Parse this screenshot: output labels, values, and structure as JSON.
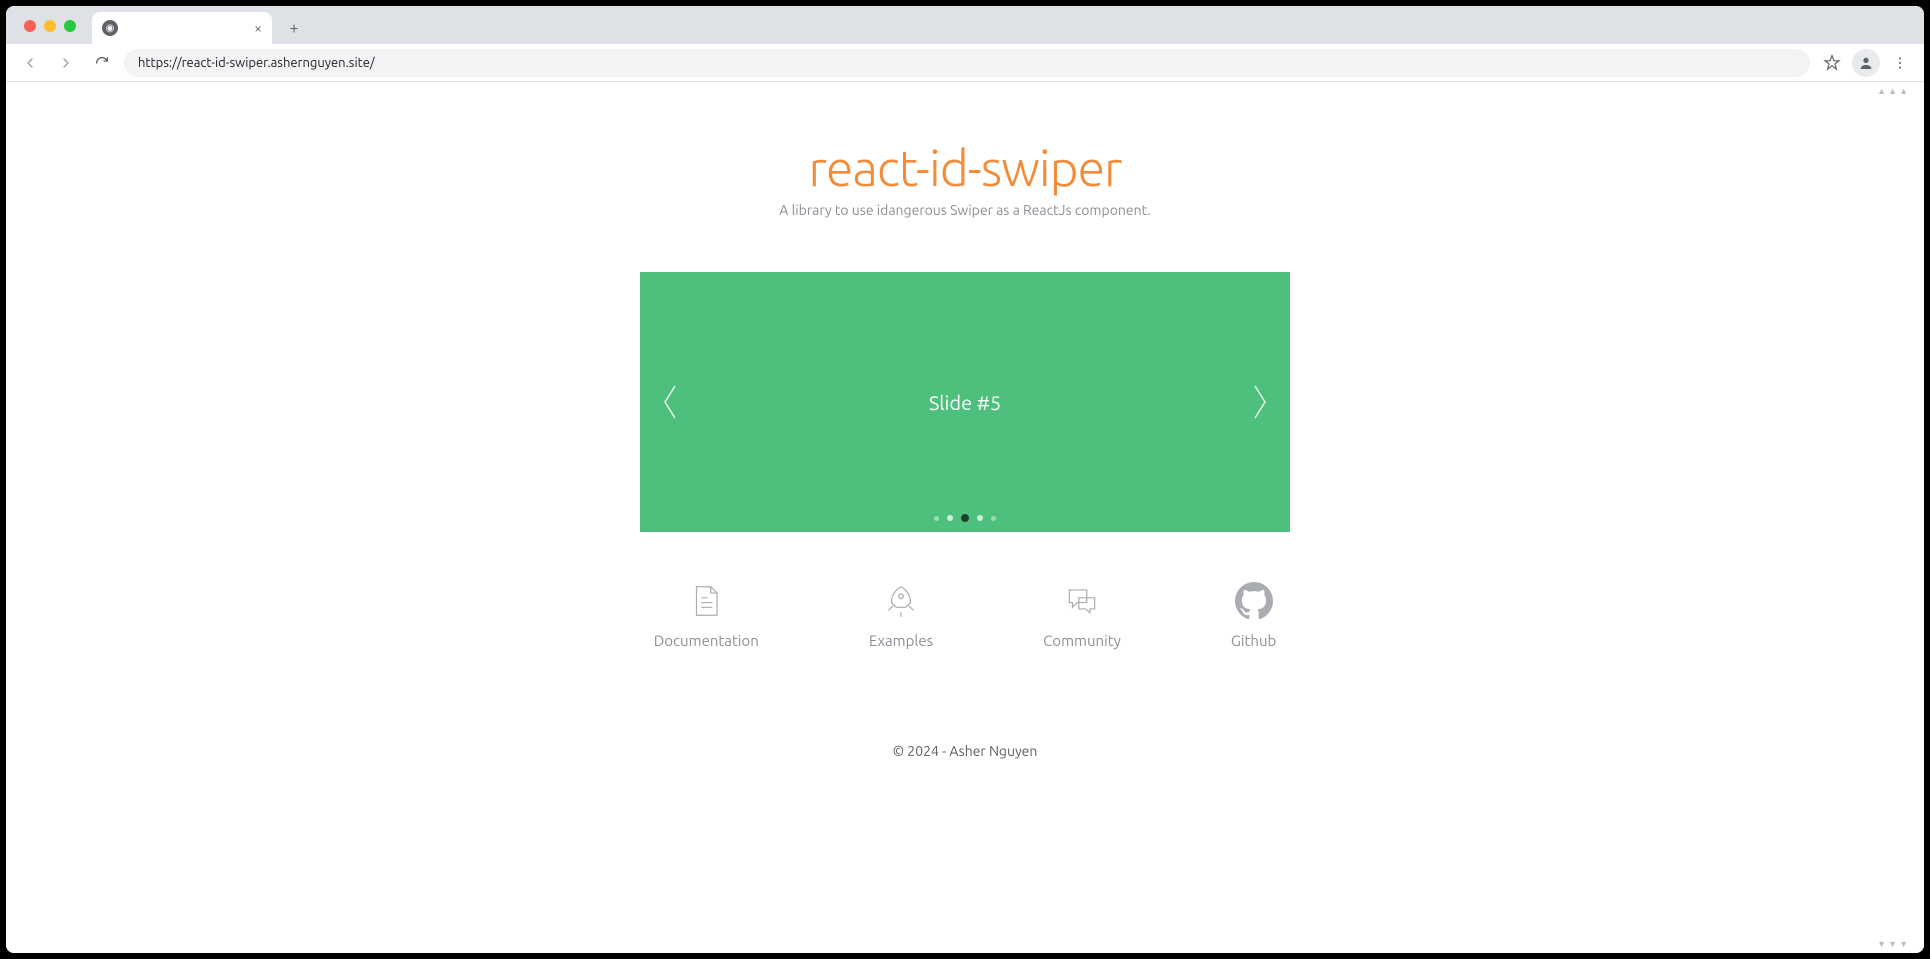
{
  "browser": {
    "url": "https://react-id-swiper.ashernguyen.site/",
    "tab_title": ""
  },
  "header": {
    "title": "react-id-swiper",
    "subtitle": "A library to use idangerous Swiper as a ReactJs component."
  },
  "swiper": {
    "current_slide": "Slide #5",
    "bullets": 5,
    "active_index": 2
  },
  "nav": {
    "items": [
      {
        "label": "Documentation"
      },
      {
        "label": "Examples"
      },
      {
        "label": "Community"
      },
      {
        "label": "Github"
      }
    ]
  },
  "footer": {
    "text": "© 2024 - Asher Nguyen"
  }
}
